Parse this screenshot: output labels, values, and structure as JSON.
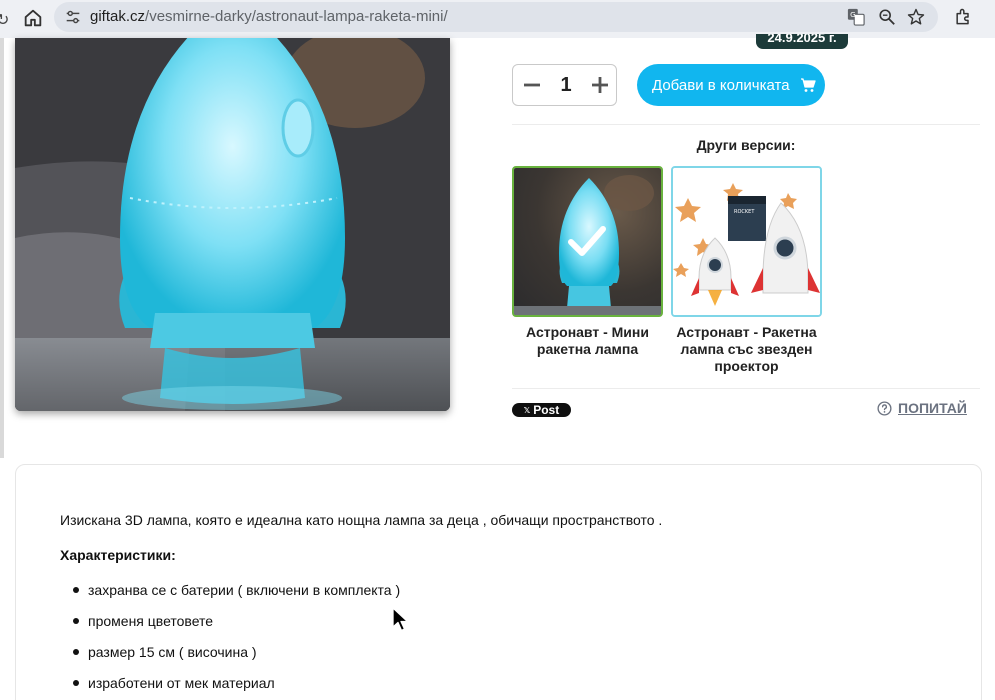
{
  "browser": {
    "url_host": "giftak.cz",
    "url_path": "/vesmirne-darky/astronaut-lampa-raketa-mini/",
    "icons": [
      "reload-icon",
      "home-icon",
      "site-settings-icon",
      "translate-icon",
      "zoom-icon",
      "bookmark-star-icon",
      "extensions-icon"
    ]
  },
  "product": {
    "date_badge": "24.9.2025 г.",
    "quantity": "1",
    "add_button_label": "Добави в количката",
    "versions_title": "Други версии:",
    "versions": [
      {
        "label": "Астронавт - Мини ракетна лампа",
        "selected": true
      },
      {
        "label": "Астронавт - Ракетна лампа със звезден проектор",
        "selected": false
      }
    ],
    "post_label": "Post",
    "ask_label": "ПОПИТАЙ"
  },
  "description": {
    "intro": "Изискана 3D лампа, която е идеална като нощна лампа за деца , обичащи пространството .",
    "features_title": "Характеристики:",
    "features": [
      "захранва се с батерии ( включени в комплекта )",
      "променя цветовете",
      "размер 15 см ( височина )",
      "изработени от мек материал"
    ]
  },
  "colors": {
    "accent_button": "#11b6ef",
    "selected_border": "#69b33e",
    "alt_border": "#7fd6e8",
    "badge_bg": "#1d3b3a",
    "muted_link": "#6b7280"
  }
}
